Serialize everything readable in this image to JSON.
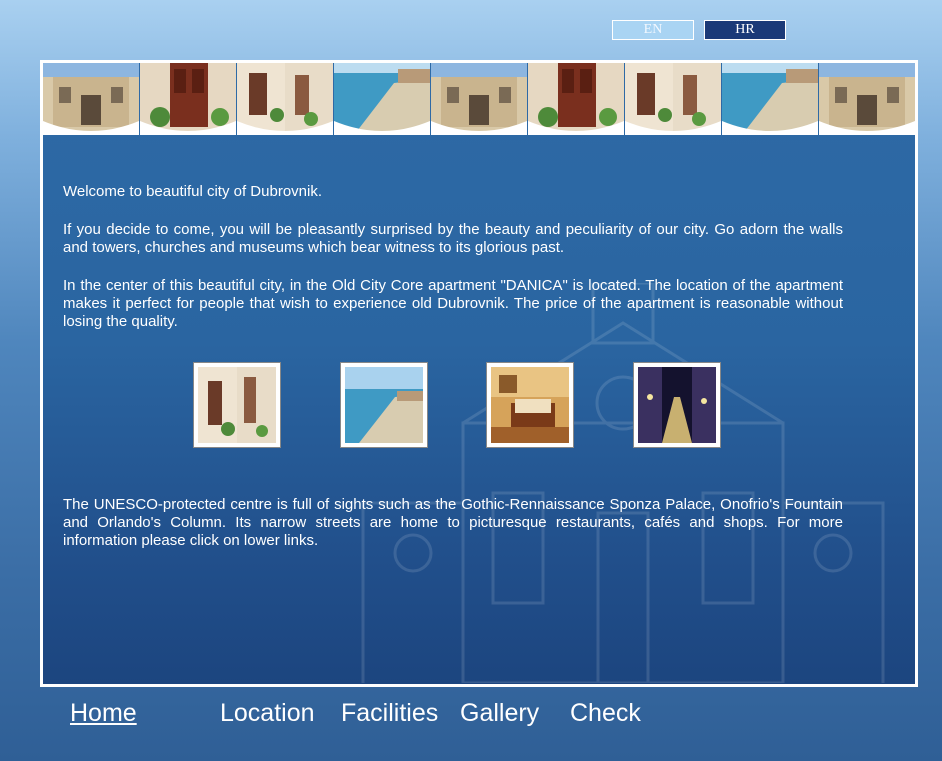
{
  "language": {
    "en_label": "EN",
    "hr_label": "HR"
  },
  "content": {
    "welcome": "Welcome to beautiful city of Dubrovnik.",
    "para1": "If you decide to come, you will be pleasantly surprised by the beauty and peculiarity of our city. Go adorn the walls and towers, churches and museums which bear witness to its glorious past.",
    "para2": "In the center of this beautiful city, in the Old City Core apartment \"DANICA\" is located. The location of the apartment makes it perfect for people that wish to experience old Dubrovnik. The price of the apartment is reasonable without losing the quality.",
    "para3": "The UNESCO-protected centre is full of sights such as the Gothic-Rennaissance Sponza Palace, Onofrio's Fountain and Orlando's Column. Its narrow streets are home to picturesque restaurants, cafés and shops. For more information please click on lower links."
  },
  "header_strip": [
    "church-photo",
    "door-photo",
    "alley-photo",
    "beach-photo",
    "church-photo",
    "door-photo",
    "alley-photo",
    "beach-photo",
    "church-photo"
  ],
  "thumbnails": [
    "alley-thumbnail",
    "beach-thumbnail",
    "bedroom-thumbnail",
    "night-street-thumbnail"
  ],
  "nav": {
    "home": "Home",
    "location": "Location",
    "facilities": "Facilities",
    "gallery": "Gallery",
    "check": "Check"
  },
  "colors": {
    "frame_border": "#ffffff",
    "content_bg": "#2a65a1",
    "lang_en_bg": "#a9d4f3",
    "lang_hr_bg": "#1b3a78"
  }
}
